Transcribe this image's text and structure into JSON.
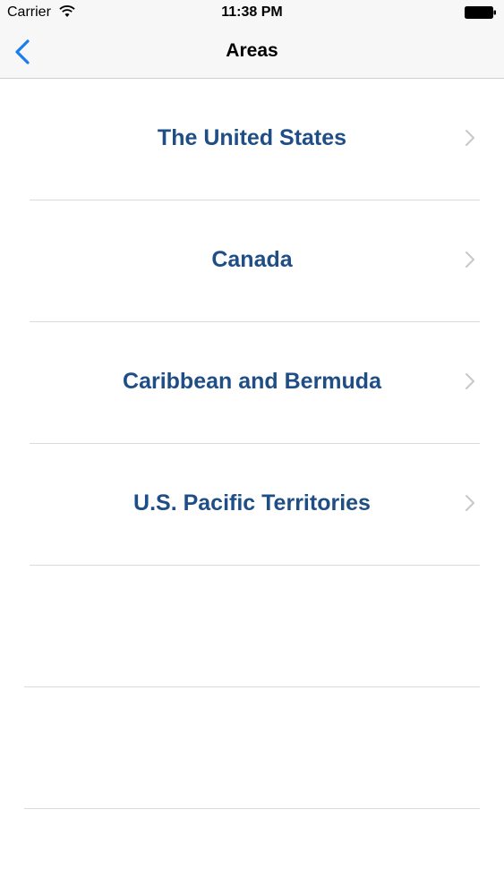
{
  "status_bar": {
    "carrier": "Carrier",
    "time": "11:38 PM",
    "wifi_icon": "wifi-icon",
    "battery_icon": "battery-icon"
  },
  "nav_bar": {
    "title": "Areas",
    "back_icon": "chevron-left-icon",
    "accent_color": "#1a7cf0"
  },
  "areas": [
    {
      "label": "The United States"
    },
    {
      "label": "Canada"
    },
    {
      "label": "Caribbean and Bermuda"
    },
    {
      "label": "U.S. Pacific Territories"
    }
  ],
  "colors": {
    "row_text": "#1f4e86",
    "chevron": "#c7c7cc",
    "separator": "#dadade",
    "bar_background": "#f7f7f7"
  }
}
